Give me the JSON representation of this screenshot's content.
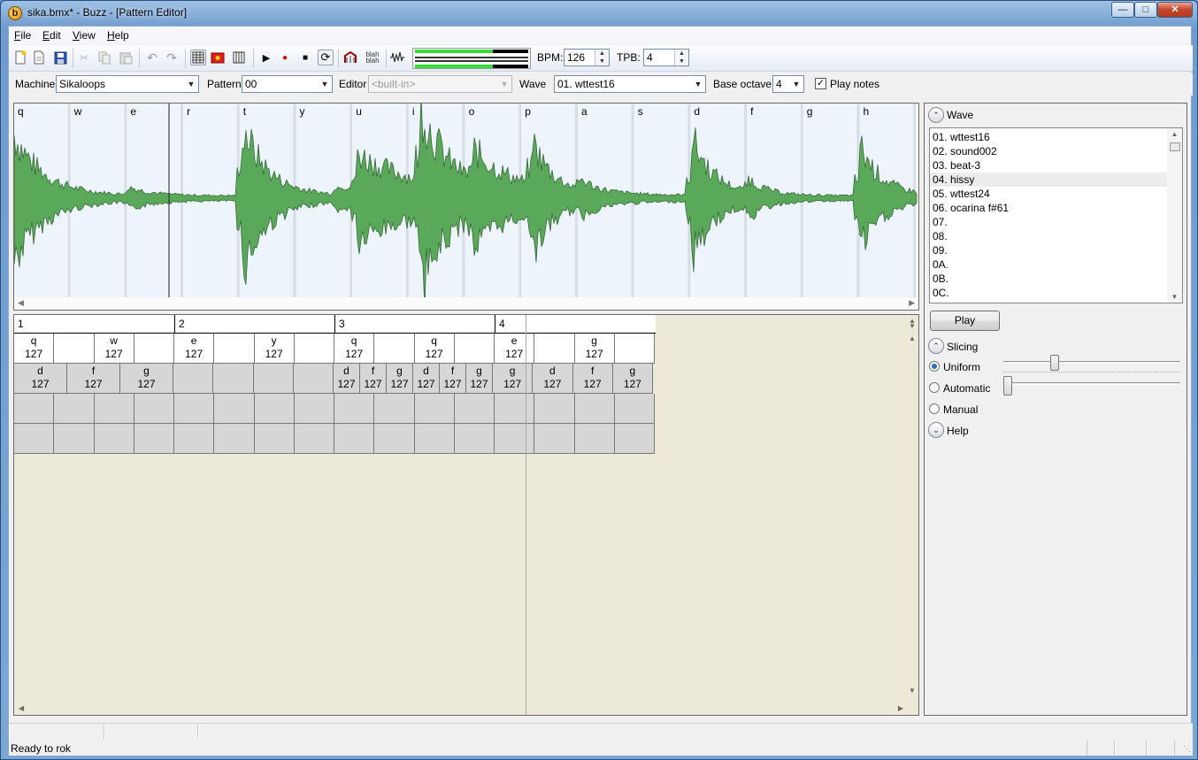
{
  "window": {
    "title": "sika.bmx* - Buzz - [Pattern Editor]",
    "icon": "buzz-icon",
    "min": "minimize-icon",
    "max": "maximize-icon",
    "close": "close-icon"
  },
  "menu": [
    {
      "label": "File",
      "key": "F",
      "rest": "ile"
    },
    {
      "label": "Edit",
      "key": "E",
      "rest": "dit"
    },
    {
      "label": "View",
      "key": "V",
      "rest": "iew"
    },
    {
      "label": "Help",
      "key": "H",
      "rest": "elp"
    }
  ],
  "toolbar": {
    "bpm_label": "BPM:",
    "bpm_value": "126",
    "tpb_label": "TPB:",
    "tpb_value": "4",
    "blah": "blah"
  },
  "selectors": {
    "machine_label": "Machine",
    "machine_value": "Sikaloops",
    "pattern_label": "Pattern",
    "pattern_value": "00",
    "editor_label": "Editor",
    "editor_value": "<built-in>",
    "wave_label": "Wave",
    "wave_value": "01. wttest16",
    "octave_label": "Base octave",
    "octave_value": "4",
    "play_notes_label": "Play notes",
    "play_notes_checked": true
  },
  "waveform": {
    "slice_keys": [
      "q",
      "w",
      "e",
      "r",
      "t",
      "y",
      "u",
      "i",
      "o",
      "p",
      "a",
      "s",
      "d",
      "f",
      "g",
      "h"
    ],
    "color": "#5aa95a"
  },
  "sequence": {
    "bars": [
      "1",
      "2",
      "3",
      "4"
    ],
    "row1": [
      {
        "n": "q",
        "v": "127"
      },
      {
        "n": "",
        "v": ""
      },
      {
        "n": "w",
        "v": "127"
      },
      {
        "n": "",
        "v": ""
      },
      {
        "n": "e",
        "v": "127"
      },
      {
        "n": "",
        "v": ""
      },
      {
        "n": "y",
        "v": "127"
      },
      {
        "n": "",
        "v": ""
      },
      {
        "n": "q",
        "v": "127"
      },
      {
        "n": "",
        "v": ""
      },
      {
        "n": "q",
        "v": "127"
      },
      {
        "n": "",
        "v": ""
      },
      {
        "n": "e",
        "v": "127"
      },
      {
        "n": "",
        "v": ""
      },
      {
        "n": "g",
        "v": "127"
      },
      {
        "n": "",
        "v": ""
      }
    ],
    "row2": [
      {
        "n": "d",
        "v": "127"
      },
      {
        "n": "f",
        "v": "127"
      },
      {
        "n": "g",
        "v": "127"
      },
      {
        "n": "",
        "v": ""
      },
      {
        "n": "",
        "v": ""
      },
      {
        "n": "",
        "v": ""
      },
      {
        "n": "",
        "v": ""
      },
      {
        "n": "d",
        "v": "127"
      },
      {
        "n": "f",
        "v": "127"
      },
      {
        "n": "g",
        "v": "127"
      },
      {
        "n": "d",
        "v": "127"
      },
      {
        "n": "f",
        "v": "127"
      },
      {
        "n": "g",
        "v": "127"
      },
      {
        "n": "g",
        "v": "127"
      },
      {
        "n": "d",
        "v": "127"
      },
      {
        "n": "f",
        "v": "127"
      },
      {
        "n": "g",
        "v": "127"
      }
    ]
  },
  "side": {
    "wave_header": "Wave",
    "waves": [
      "01. wttest16",
      "02. sound002",
      "03. beat-3",
      "04. hissy",
      "05. wttest24",
      "06. ocarina f#61",
      "07.",
      "08.",
      "09.",
      "0A.",
      "0B.",
      "0C."
    ],
    "selected_index": 3,
    "play_label": "Play",
    "slicing_header": "Slicing",
    "uniform_label": "Uniform",
    "automatic_label": "Automatic",
    "manual_label": "Manual",
    "selected_mode": "Uniform",
    "uniform_slider_level": 0.28,
    "automatic_slider_level": 0.0,
    "help_header": "Help"
  },
  "status": {
    "text": "Ready to rok"
  }
}
